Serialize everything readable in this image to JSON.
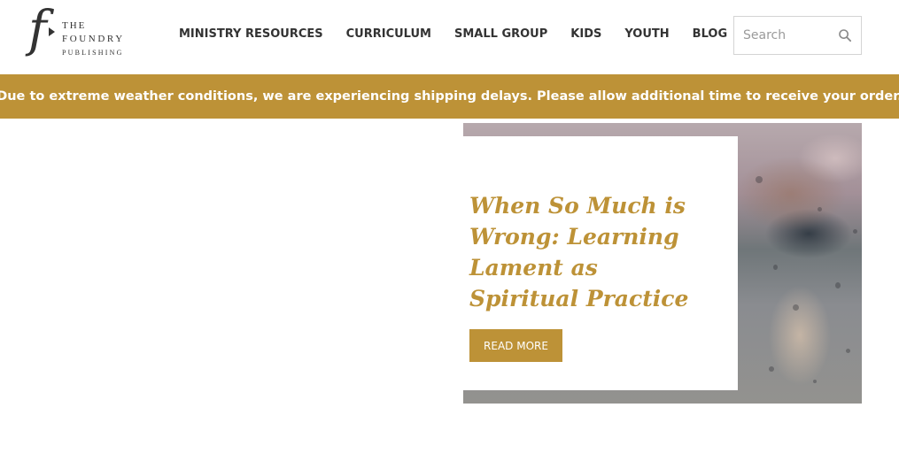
{
  "brand": {
    "logo_letter": "f",
    "logo_line1": "THE",
    "logo_line2": "FOUNDRY",
    "logo_line3": "PUBLISHING"
  },
  "nav": {
    "items": [
      {
        "label": "MINISTRY RESOURCES"
      },
      {
        "label": "CURRICULUM"
      },
      {
        "label": "SMALL GROUP"
      },
      {
        "label": "KIDS"
      },
      {
        "label": "YOUTH"
      },
      {
        "label": "BLOG"
      }
    ]
  },
  "search": {
    "placeholder": "Search",
    "value": "",
    "icon": "search-icon"
  },
  "banner": {
    "text": "Due to extreme weather conditions, we are experiencing shipping delays. Please allow additional time to receive your order."
  },
  "feature": {
    "title": "When So Much is Wrong: Learning Lament as Spiritual Practice",
    "button_label": "READ MORE"
  },
  "colors": {
    "accent": "#bd9237",
    "text": "#333333",
    "background": "#ffffff"
  }
}
